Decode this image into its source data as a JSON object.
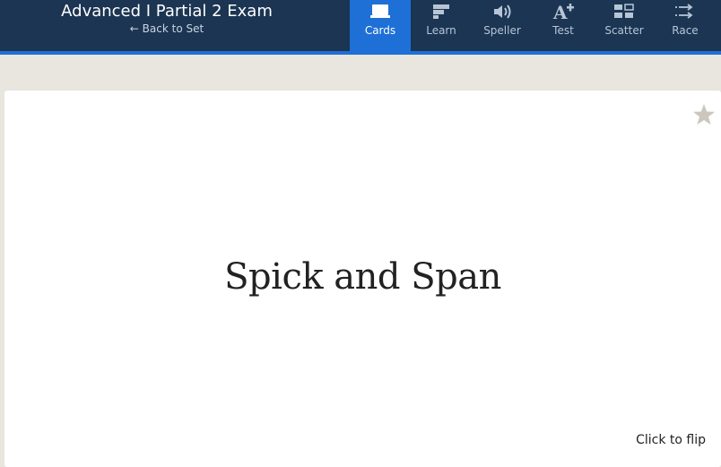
{
  "header": {
    "set_title": "Advanced I Partial 2 Exam",
    "back_link": "← Back to Set"
  },
  "modes": [
    {
      "label": "Cards",
      "icon": "cards-icon",
      "active": true
    },
    {
      "label": "Learn",
      "icon": "learn-icon",
      "active": false
    },
    {
      "label": "Speller",
      "icon": "speaker-icon",
      "active": false
    },
    {
      "label": "Test",
      "icon": "test-icon",
      "active": false
    },
    {
      "label": "Scatter",
      "icon": "scatter-icon",
      "active": false
    },
    {
      "label": "Race",
      "icon": "race-icon",
      "active": false
    }
  ],
  "card": {
    "term": "Spick and Span",
    "flip_hint": "Click to flip",
    "starred": false
  },
  "colors": {
    "header_bg": "#1b3552",
    "accent": "#1e6fd6",
    "page_bg": "#e9e5df",
    "star": "#ccc6bd"
  }
}
